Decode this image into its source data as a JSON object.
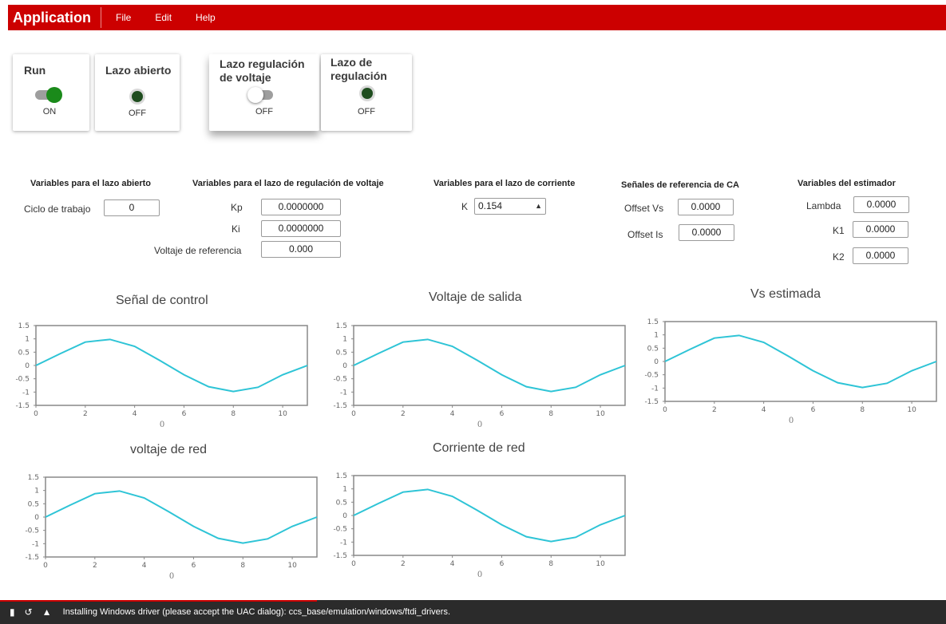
{
  "menu": {
    "title": "Application",
    "items": [
      "File",
      "Edit",
      "Help"
    ]
  },
  "switches": [
    {
      "title": "Run",
      "state": "ON"
    },
    {
      "title": "Lazo abierto",
      "state": "OFF"
    },
    {
      "title": "Lazo regulación de voltaje",
      "state": "OFF"
    },
    {
      "title": "Lazo de regulación",
      "state": "OFF"
    }
  ],
  "vars": {
    "open_loop": {
      "header": "Variables para el lazo abierto",
      "duty_label": "Ciclo de trabajo",
      "duty_value": "0"
    },
    "voltage_loop": {
      "header": "Variables para el lazo de regulación de voltaje",
      "kp_label": "Kp",
      "kp_value": "0.0000000",
      "ki_label": "Ki",
      "ki_value": "0.0000000",
      "vref_label": "Voltaje de referencia",
      "vref_value": "0.000"
    },
    "current_loop": {
      "header": "Variables para el lazo de corriente",
      "k_label": "K",
      "k_value": "0.154"
    },
    "ref_signals": {
      "header": "Señales de referencia de CA",
      "offset_vs_label": "Offset Vs",
      "offset_vs_value": "0.0000",
      "offset_is_label": "Offset Is",
      "offset_is_value": "0.0000"
    },
    "estimator": {
      "header": "Variables del estimador",
      "lambda_label": "Lambda",
      "lambda_value": "0.0000",
      "k1_label": "K1",
      "k1_value": "0.0000",
      "k2_label": "K2",
      "k2_value": "0.0000"
    }
  },
  "chart_data": [
    {
      "type": "line",
      "title": "Señal de control",
      "xlabel": "0",
      "ylabel": "",
      "x": [
        0,
        1,
        2,
        3,
        4,
        5,
        6,
        7,
        8,
        9,
        10,
        11
      ],
      "series": [
        {
          "values": [
            0,
            0.45,
            0.88,
            0.98,
            0.72,
            0.2,
            -0.35,
            -0.8,
            -0.98,
            -0.82,
            -0.35,
            0
          ]
        }
      ],
      "xlim": [
        0,
        11
      ],
      "ylim": [
        -1.5,
        1.5
      ],
      "xticks": [
        0,
        2,
        4,
        6,
        8,
        10
      ],
      "yticks": [
        "1.5",
        "1",
        "0.5",
        "0",
        "-0.5",
        "-1",
        "-1.5"
      ],
      "color": "#2ec4d6"
    },
    {
      "type": "line",
      "title": "Voltaje de salida",
      "xlabel": "0",
      "ylabel": "",
      "x": [
        0,
        1,
        2,
        3,
        4,
        5,
        6,
        7,
        8,
        9,
        10,
        11
      ],
      "series": [
        {
          "values": [
            0,
            0.45,
            0.88,
            0.98,
            0.72,
            0.2,
            -0.35,
            -0.8,
            -0.98,
            -0.82,
            -0.35,
            0
          ]
        }
      ],
      "xlim": [
        0,
        11
      ],
      "ylim": [
        -1.5,
        1.5
      ],
      "xticks": [
        0,
        2,
        4,
        6,
        8,
        10
      ],
      "yticks": [
        "1.5",
        "1",
        "0.5",
        "0",
        "-0.5",
        "-1",
        "-1.5"
      ],
      "color": "#2ec4d6"
    },
    {
      "type": "line",
      "title": "Vs estimada",
      "xlabel": "0",
      "ylabel": "",
      "x": [
        0,
        1,
        2,
        3,
        4,
        5,
        6,
        7,
        8,
        9,
        10,
        11
      ],
      "series": [
        {
          "values": [
            0,
            0.45,
            0.88,
            0.98,
            0.72,
            0.2,
            -0.35,
            -0.8,
            -0.98,
            -0.82,
            -0.35,
            0
          ]
        }
      ],
      "xlim": [
        0,
        11
      ],
      "ylim": [
        -1.5,
        1.5
      ],
      "xticks": [
        0,
        2,
        4,
        6,
        8,
        10
      ],
      "yticks": [
        "1.5",
        "1",
        "0.5",
        "0",
        "-0.5",
        "-1",
        "-1.5"
      ],
      "color": "#2ec4d6"
    },
    {
      "type": "line",
      "title": "voltaje de red",
      "xlabel": "0",
      "ylabel": "",
      "x": [
        0,
        1,
        2,
        3,
        4,
        5,
        6,
        7,
        8,
        9,
        10,
        11
      ],
      "series": [
        {
          "values": [
            0,
            0.45,
            0.88,
            0.98,
            0.72,
            0.2,
            -0.35,
            -0.8,
            -0.98,
            -0.82,
            -0.35,
            0
          ]
        }
      ],
      "xlim": [
        0,
        11
      ],
      "ylim": [
        -1.5,
        1.5
      ],
      "xticks": [
        0,
        2,
        4,
        6,
        8,
        10
      ],
      "yticks": [
        "1.5",
        "1",
        "0.5",
        "0",
        "-0.5",
        "-1",
        "-1.5"
      ],
      "color": "#2ec4d6"
    },
    {
      "type": "line",
      "title": "Corriente de red",
      "xlabel": "0",
      "ylabel": "",
      "x": [
        0,
        1,
        2,
        3,
        4,
        5,
        6,
        7,
        8,
        9,
        10,
        11
      ],
      "series": [
        {
          "values": [
            0,
            0.45,
            0.88,
            0.98,
            0.72,
            0.2,
            -0.35,
            -0.8,
            -0.98,
            -0.82,
            -0.35,
            0
          ]
        }
      ],
      "xlim": [
        0,
        11
      ],
      "ylim": [
        -1.5,
        1.5
      ],
      "xticks": [
        0,
        2,
        4,
        6,
        8,
        10
      ],
      "yticks": [
        "1.5",
        "1",
        "0.5",
        "0",
        "-0.5",
        "-1",
        "-1.5"
      ],
      "color": "#2ec4d6"
    }
  ],
  "status": {
    "progress": 0.335,
    "progress_color": "#cc0000",
    "icons": [
      "book-icon",
      "connection-icon",
      "caret-up-icon"
    ],
    "message": "Installing Windows driver (please accept the UAC dialog): ccs_base/emulation/windows/ftdi_drivers."
  }
}
